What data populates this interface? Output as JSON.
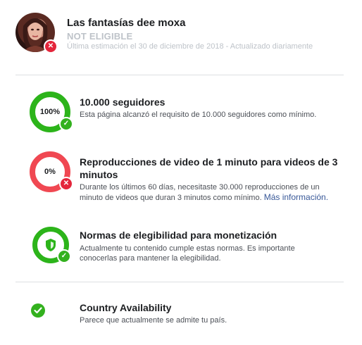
{
  "header": {
    "page_name": "Las fantasías dee moxa",
    "status": "NOT ELIGIBLE",
    "updated": "Última estimación el 30 de diciembre de 2018 - Actualizado diariamente"
  },
  "criteria": [
    {
      "progress_label": "100%",
      "progress": 1.0,
      "state": "met",
      "title": "10.000 seguidores",
      "description": "Esta página alcanzó el requisito de 10.000 seguidores como mínimo."
    },
    {
      "progress_label": "0%",
      "progress": 0.0,
      "state": "not-met",
      "title_line1": "Reproducciones de video de 1 minuto para videos de 3",
      "title_line2": "minutos",
      "description_line1": "Durante los últimos 60 días, necesitaste 30.000 reproducciones de un",
      "description_line2": "minuto de videos que duran 3 minutos como mínimo.",
      "link": "Más información."
    },
    {
      "state": "met",
      "title": "Normas de elegibilidad para monetización",
      "description_line1": "Actualmente tu contenido cumple estas normas. Es importante",
      "description_line2": "conocerlas para mantener la elegibilidad."
    },
    {
      "state": "met",
      "title": "Country Availability",
      "description": "Parece que actualmente se admite tu país."
    }
  ],
  "colors": {
    "green": "#2cb41a",
    "red": "#f04852",
    "muted": "#bec3c9",
    "link": "#385898"
  }
}
